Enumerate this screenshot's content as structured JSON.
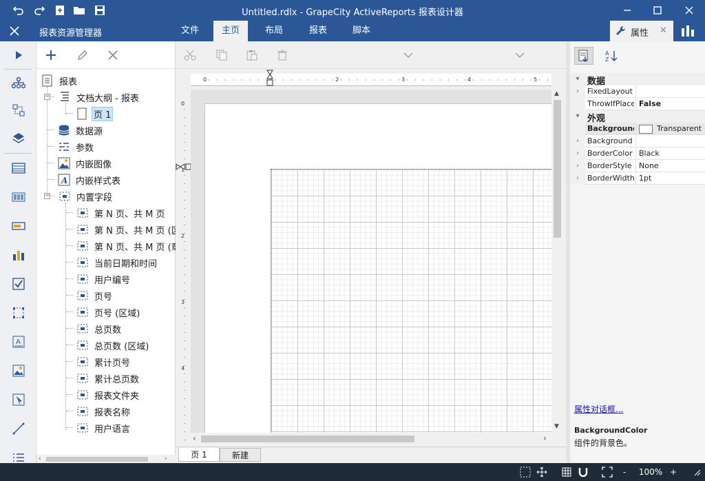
{
  "window": {
    "title": "Untitled.rdlx - GrapeCity ActiveReports 报表设计器"
  },
  "menubar": {
    "explorer_title": "报表资源管理器",
    "tabs": [
      "文件",
      "主页",
      "布局",
      "报表",
      "脚本"
    ],
    "active_tab": "主页",
    "properties_tab": "属性"
  },
  "toolbox": {
    "icons": [
      "run-icon",
      "tree-icon",
      "layout-icon",
      "layers-icon",
      "table-icon",
      "barcode-icon",
      "textbox-icon",
      "chart-icon",
      "checkbox-icon",
      "container-icon",
      "formatted-text-icon",
      "image-icon",
      "pointer-icon",
      "line-icon",
      "list-icon"
    ]
  },
  "explorer": {
    "root": "报表",
    "nodes": [
      {
        "label": "文档大纲 - 报表",
        "level": 1,
        "icon": "outline-icon",
        "expander": "−"
      },
      {
        "label": "页 1",
        "level": 2,
        "icon": "page-icon",
        "selected": true
      },
      {
        "label": "数据源",
        "level": 1,
        "icon": "database-icon"
      },
      {
        "label": "参数",
        "level": 1,
        "icon": "parameters-icon"
      },
      {
        "label": "内嵌图像",
        "level": 1,
        "icon": "image-icon"
      },
      {
        "label": "内嵌样式表",
        "level": 1,
        "icon": "stylesheet-icon"
      },
      {
        "label": "内置字段",
        "level": 1,
        "icon": "field-icon",
        "expander": "−"
      },
      {
        "label": "第 N 页、共 M 页",
        "level": 2,
        "icon": "field-icon"
      },
      {
        "label": "第 N 页、共 M 页 (区",
        "level": 2,
        "icon": "field-icon"
      },
      {
        "label": "第 N 页、共 M 页 (章",
        "level": 2,
        "icon": "field-icon"
      },
      {
        "label": "当前日期和时间",
        "level": 2,
        "icon": "field-icon"
      },
      {
        "label": "用户编号",
        "level": 2,
        "icon": "field-icon"
      },
      {
        "label": "页号",
        "level": 2,
        "icon": "field-icon"
      },
      {
        "label": "页号 (区域)",
        "level": 2,
        "icon": "field-icon"
      },
      {
        "label": "总页数",
        "level": 2,
        "icon": "field-icon"
      },
      {
        "label": "总页数 (区域)",
        "level": 2,
        "icon": "field-icon"
      },
      {
        "label": "累计页号",
        "level": 2,
        "icon": "field-icon"
      },
      {
        "label": "累计总页数",
        "level": 2,
        "icon": "field-icon"
      },
      {
        "label": "报表文件夹",
        "level": 2,
        "icon": "field-icon"
      },
      {
        "label": "报表名称",
        "level": 2,
        "icon": "field-icon"
      },
      {
        "label": "用户语言",
        "level": 2,
        "icon": "field-icon"
      }
    ]
  },
  "designer": {
    "ruler_h": [
      "0",
      "1",
      "2",
      "3",
      "4",
      "5"
    ],
    "ruler_v": [
      "0",
      "1",
      "2",
      "3",
      "4"
    ],
    "page_tabs": [
      "页 1",
      "新建"
    ]
  },
  "properties": {
    "rows": [
      {
        "type": "cat",
        "key": "数据",
        "expander": "▾"
      },
      {
        "type": "prop",
        "key": "FixedLayout",
        "value": "",
        "expander": "›"
      },
      {
        "type": "prop",
        "key": "ThrowIfPlace",
        "value": "False",
        "bold_value": true
      },
      {
        "type": "cat",
        "key": "外观",
        "expander": "▾"
      },
      {
        "type": "prop",
        "key": "Background",
        "value": "Transparent",
        "swatch": true,
        "highlight": true
      },
      {
        "type": "prop",
        "key": "Background",
        "value": "",
        "expander": "›"
      },
      {
        "type": "prop",
        "key": "BorderColor",
        "value": "Black",
        "expander": "›"
      },
      {
        "type": "prop",
        "key": "BorderStyle",
        "value": "None",
        "expander": "›"
      },
      {
        "type": "prop",
        "key": "BorderWidth",
        "value": "1pt",
        "expander": "›"
      }
    ],
    "dialog_link": "属性对话框...",
    "desc_title": "BackgroundColor",
    "desc_text": "组件的背景色。"
  },
  "statusbar": {
    "zoom": "100%",
    "minus": "-",
    "plus": "+"
  },
  "colors": {
    "titlebar": "#2b5797",
    "statusbar": "#1f2b38",
    "accent": "#2b5797"
  }
}
